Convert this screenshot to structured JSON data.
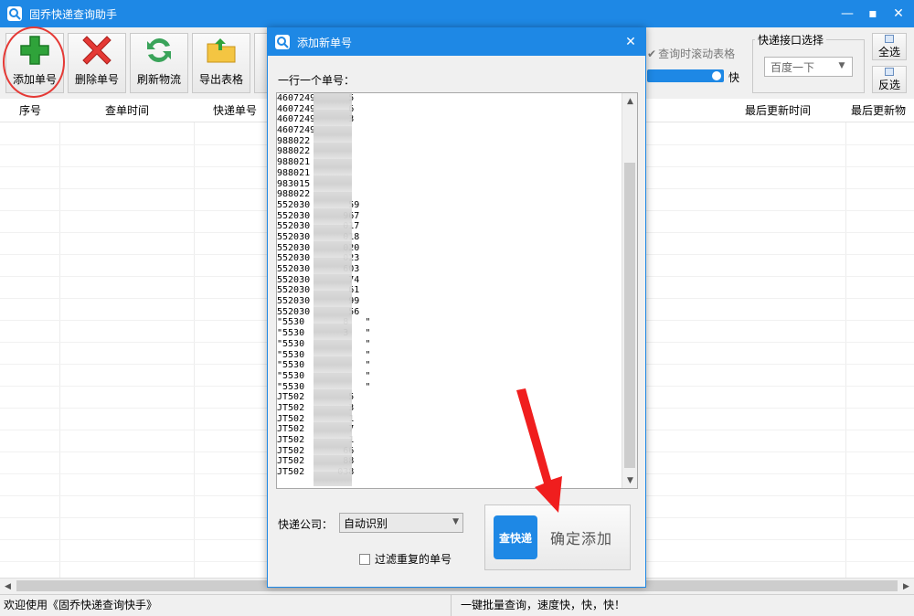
{
  "window": {
    "title": "固乔快递查询助手"
  },
  "toolbar": {
    "add": "添加单号",
    "delete": "删除单号",
    "refresh": "刷新物流",
    "export": "导出表格",
    "scroll_label": "查询时滚动表格",
    "speed_fast": "快",
    "api_group": "快递接口选择",
    "api_value": "百度一下",
    "select_all": "全选",
    "invert": "反选"
  },
  "grid": {
    "columns": [
      "序号",
      "查单时间",
      "快递单号",
      "最后更新时间",
      "最后更新物"
    ]
  },
  "status": {
    "left": "欢迎使用《固乔快递查询快手》",
    "right": "一键批量查询，速度快，快，快！"
  },
  "dialog": {
    "title": "添加新单号",
    "prompt": "一行一个单号：",
    "lines": [
      "4607249      5",
      "4607249      6",
      "4607249      3",
      "4607249",
      "988022",
      "988022",
      "988021",
      "988021",
      "983015",
      "988022",
      "552030       59",
      "552030      967",
      "552030      017",
      "552030      018",
      "552030      020",
      "552030      023",
      "552030      603",
      "552030       74",
      "552030       61",
      "552030       99",
      "552030       56",
      "\"5530       8   \"",
      "\"5530       3   \"",
      "\"5530           \"",
      "\"5530           \"",
      "\"5530           \"",
      "\"5530           \"",
      "\"5530           \"",
      "JT502        5",
      "JT502        3",
      "JT502        1",
      "JT502        7",
      "JT502        1",
      "JT502       66",
      "JT502       88",
      "JT502      038"
    ],
    "company_label": "快递公司：",
    "company_value": "自动识别",
    "filter_label": "过滤重复的单号",
    "confirm_icon_text": "查快递",
    "confirm_label": "确定添加"
  },
  "colors": {
    "accent": "#1e88e5",
    "highlight": "#e53935"
  }
}
